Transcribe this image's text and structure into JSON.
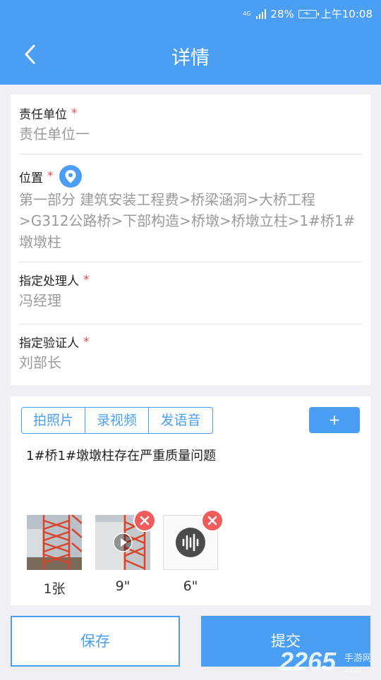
{
  "status_bar": {
    "network": "4G",
    "battery": "28%",
    "time": "上午10:08"
  },
  "app_bar": {
    "title": "详情",
    "back_icon": "chevron-left-icon"
  },
  "fields": [
    {
      "label": "责任单位",
      "required_mark": "*",
      "value": "责任单位一"
    },
    {
      "label": "位置",
      "required_mark": "*",
      "value": "第一部分 建筑安装工程费>桥梁涵洞>大桥工程>G312公路桥>下部构造>桥墩>桥墩立柱>1#桥1#墩墩柱",
      "icon": "location-pin-icon"
    },
    {
      "label": "指定处理人",
      "required_mark": "*",
      "value": "冯经理"
    },
    {
      "label": "指定验证人",
      "required_mark": "*",
      "value": "刘部长"
    }
  ],
  "media": {
    "tabs": [
      "拍照片",
      "录视频",
      "发语音"
    ],
    "add_label": "+",
    "description": "1#桥1#墩墩柱存在严重质量问题",
    "attachments": [
      {
        "type": "photo",
        "caption": "1张"
      },
      {
        "type": "video",
        "caption": "9\""
      },
      {
        "type": "audio",
        "caption": "6\""
      }
    ]
  },
  "actions": {
    "save": "保存",
    "submit": "提交"
  },
  "watermark": "2265.com 手游网",
  "colors": {
    "primary": "#4a9ff5",
    "required": "#e84a4a",
    "delete": "#f05c5c"
  }
}
